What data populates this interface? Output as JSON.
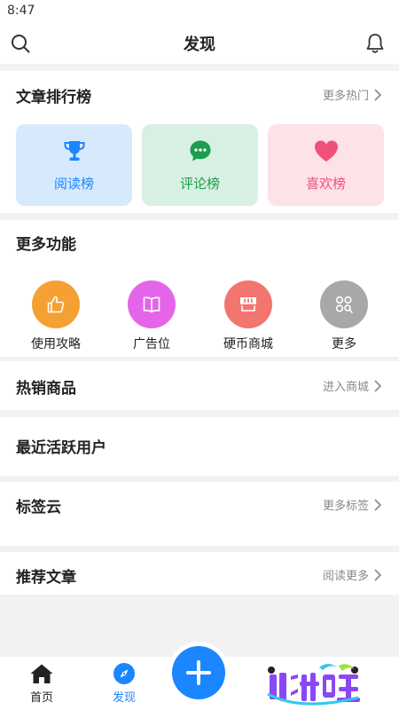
{
  "status": {
    "time": "8:47"
  },
  "header": {
    "title": "发现",
    "search_icon": "search-icon",
    "notify_icon": "bell-icon"
  },
  "ranking": {
    "title": "文章排行榜",
    "more": "更多热门",
    "cards": [
      {
        "label": "阅读榜",
        "icon": "trophy-icon",
        "bg": "#d7e9fd",
        "color": "#1a86ff"
      },
      {
        "label": "评论榜",
        "icon": "comment-icon",
        "bg": "#d8f0e3",
        "color": "#1a9e4d"
      },
      {
        "label": "喜欢榜",
        "icon": "heart-icon",
        "bg": "#fde2e8",
        "color": "#f0507a"
      }
    ]
  },
  "features": {
    "title": "更多功能",
    "items": [
      {
        "label": "使用攻略",
        "icon": "thumbs-up-icon",
        "color": "#f5a033"
      },
      {
        "label": "广告位",
        "icon": "book-icon",
        "color": "#e565e9"
      },
      {
        "label": "硬币商城",
        "icon": "shop-icon",
        "color": "#f27570"
      },
      {
        "label": "更多",
        "icon": "grid-search-icon",
        "color": "#a8a8a8"
      }
    ]
  },
  "hot_goods": {
    "title": "热销商品",
    "more": "进入商城"
  },
  "active_users": {
    "title": "最近活跃用户"
  },
  "tag_cloud": {
    "title": "标签云",
    "more": "更多标签"
  },
  "recommended": {
    "title": "推荐文章",
    "more": "阅读更多"
  },
  "tabbar": {
    "tabs": [
      {
        "label": "首页",
        "icon": "home-icon"
      },
      {
        "label": "发现",
        "icon": "compass-icon",
        "active": true
      }
    ],
    "fab_icon": "plus-icon",
    "accent": "#1a86ff"
  }
}
